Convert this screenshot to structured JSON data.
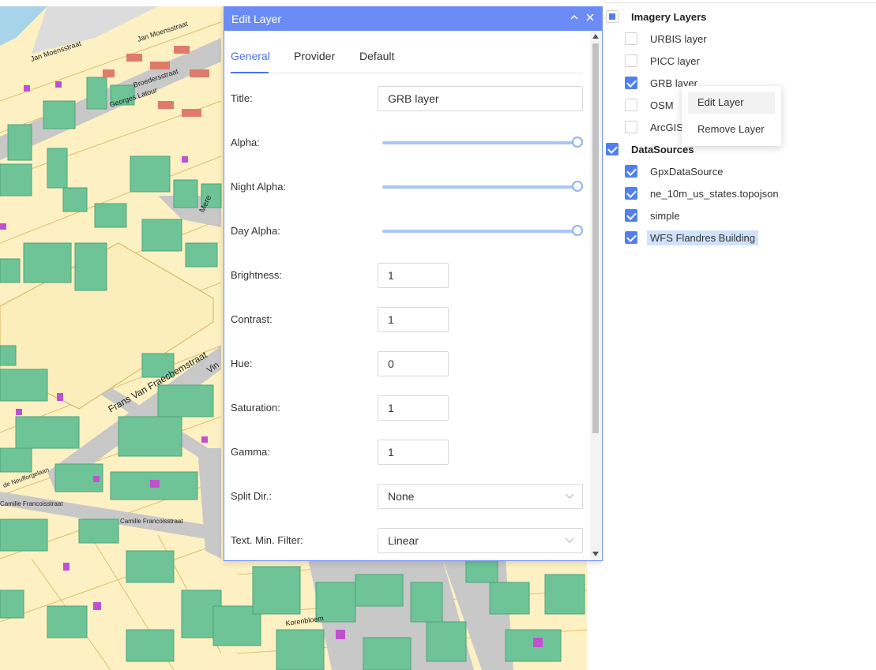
{
  "map": {
    "street_labels": [
      "Jan Moensstraat",
      "Jan Moensstraat",
      "Georges Latour",
      "Broedersstraat",
      "Frans Van Fraechemstraat",
      "Camille Francoisstraat",
      "Camille Francoisstraat",
      "de Neufforgelaan",
      "Korenbloem",
      "Mere",
      "Vin"
    ]
  },
  "dialog": {
    "title": "Edit Layer",
    "collapse_icon": "chevron-up-icon",
    "close_icon": "close-icon",
    "tabs": [
      {
        "label": "General",
        "active": true
      },
      {
        "label": "Provider",
        "active": false
      },
      {
        "label": "Default",
        "active": false
      }
    ],
    "fields": {
      "title": {
        "label": "Title:",
        "value": "GRB layer"
      },
      "alpha": {
        "label": "Alpha:",
        "level": 1.0
      },
      "night_alpha": {
        "label": "Night Alpha:",
        "level": 1.0
      },
      "day_alpha": {
        "label": "Day Alpha:",
        "level": 1.0
      },
      "brightness": {
        "label": "Brightness:",
        "value": "1"
      },
      "contrast": {
        "label": "Contrast:",
        "value": "1"
      },
      "hue": {
        "label": "Hue:",
        "value": "0"
      },
      "saturation": {
        "label": "Saturation:",
        "value": "1"
      },
      "gamma": {
        "label": "Gamma:",
        "value": "1"
      },
      "split_dir": {
        "label": "Split Dir.:",
        "value": "None"
      },
      "min_filter": {
        "label": "Text. Min. Filter:",
        "value": "Linear"
      }
    }
  },
  "tree": {
    "groups": [
      {
        "label": "Imagery Layers",
        "state": "indeterminate",
        "items": [
          {
            "label": "URBIS layer",
            "checked": false,
            "selected": false
          },
          {
            "label": "PICC layer",
            "checked": false,
            "selected": false
          },
          {
            "label": "GRB layer",
            "checked": true,
            "selected": false
          },
          {
            "label": "OSM",
            "checked": false,
            "selected": false
          },
          {
            "label": "ArcGIS",
            "checked": false,
            "selected": false
          }
        ]
      },
      {
        "label": "DataSources",
        "state": "checked",
        "items": [
          {
            "label": "GpxDataSource",
            "checked": true,
            "selected": false
          },
          {
            "label": "ne_10m_us_states.topojson",
            "checked": true,
            "selected": false
          },
          {
            "label": "simple",
            "checked": true,
            "selected": false
          },
          {
            "label": "WFS Flandres Building",
            "checked": true,
            "selected": true
          }
        ]
      }
    ]
  },
  "context_menu": {
    "items": [
      "Edit Layer",
      "Remove Layer"
    ]
  },
  "colors": {
    "accent": "#6b8cf4",
    "checkbox": "#4f7ff0",
    "building": "#6ec496",
    "parcel": "#fdf1c3",
    "road": "#c8c8c8"
  }
}
